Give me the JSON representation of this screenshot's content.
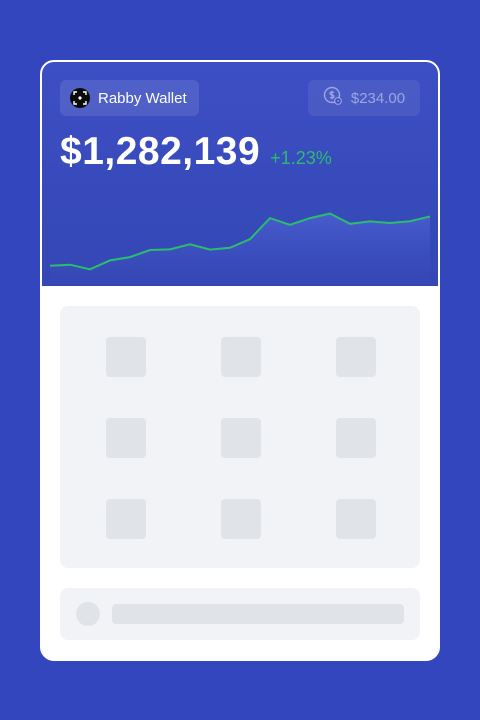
{
  "header": {
    "wallet_name": "Rabby Wallet",
    "gas_value": "$234.00",
    "balance": "$1,282,139",
    "change": "+1.23%"
  },
  "chart_data": {
    "type": "area",
    "x": [
      0,
      1,
      2,
      3,
      4,
      5,
      6,
      7,
      8,
      9,
      10,
      11,
      12,
      13,
      14,
      15,
      16,
      17,
      18,
      19
    ],
    "values": [
      0.88,
      0.95,
      0.62,
      1.26,
      1.49,
      2.0,
      2.04,
      2.41,
      2.03,
      2.16,
      2.77,
      4.28,
      3.8,
      4.28,
      4.61,
      3.87,
      4.04,
      3.93,
      4.06,
      4.39
    ],
    "line_color": "#2bbd6e",
    "title": "",
    "xlabel": "",
    "ylabel": ""
  },
  "colors": {
    "background": "#3446be",
    "header": "#3a4bbf",
    "positive": "#2bbd6e",
    "placeholder": "#e0e3e8",
    "panel": "#f2f3f6"
  },
  "icons": {
    "wallet": "rabby-logo-icon",
    "gas": "dollar-coin-settings-icon"
  }
}
